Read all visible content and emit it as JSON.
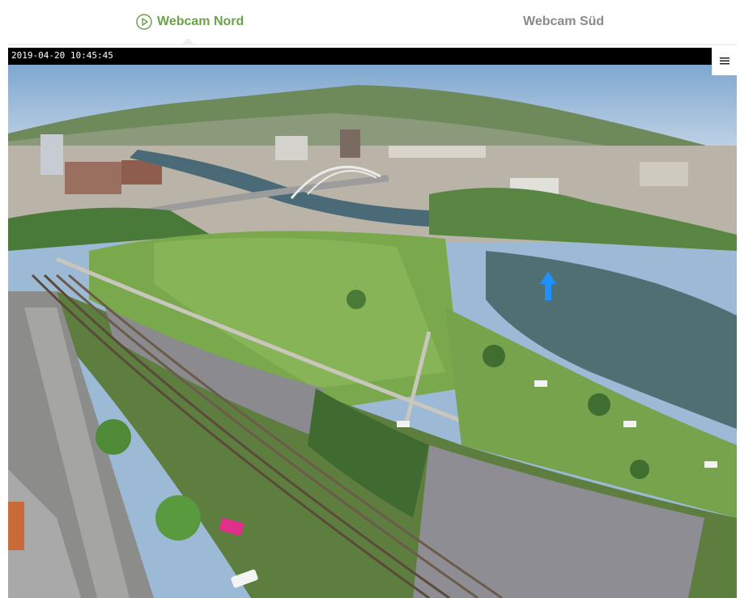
{
  "tabs": [
    {
      "label": "Webcam Nord",
      "active": true,
      "icon": "play-circle-icon"
    },
    {
      "label": "Webcam Süd",
      "active": false
    }
  ],
  "player": {
    "timestamp": "2019-04-20 10:45:45",
    "menu_icon": "hamburger-menu-icon",
    "marker_icon": "up-arrow-icon"
  },
  "colors": {
    "accent": "#6aa24a",
    "inactive_tab": "#8a8a8a",
    "marker": "#1e90ff"
  }
}
